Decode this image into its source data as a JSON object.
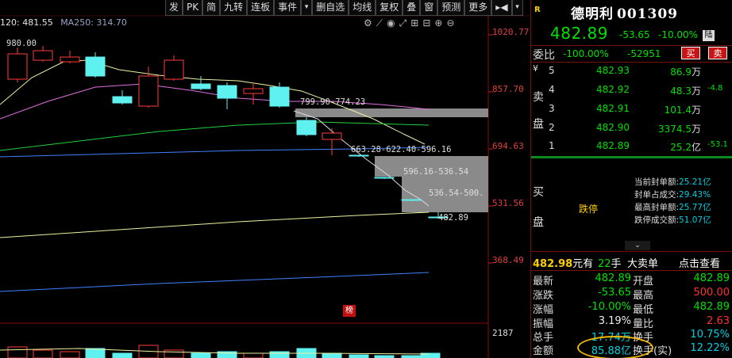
{
  "toolbar": {
    "items": [
      "发",
      "PK",
      "简",
      "九转",
      "连板",
      "事件",
      "▾",
      "删自选",
      "均线",
      "复权",
      "叠",
      "窗",
      "预测",
      "更多",
      "▸◀",
      "▾"
    ]
  },
  "ma_legend": {
    "ma120": "120: 481.55",
    "ma250": "MA250: 314.70"
  },
  "chart_icons": [
    "⚙",
    "⟋",
    "◉",
    "⤢",
    "⊞",
    "⊟",
    "⊕",
    "⊖"
  ],
  "price_axis": [
    "1020.77",
    "857.70",
    "694.63",
    "531.56",
    "368.49"
  ],
  "volume_axis": "2187",
  "annotations": {
    "peak": "980.00",
    "gap1": "799.90-774.23",
    "gap2": "663.28-622.40-596.16",
    "gap3": "596.16-536.54",
    "gap4": "536.54-500.",
    "last": "482.89"
  },
  "bang_badge": "榜",
  "panel": {
    "r_badge": "R",
    "stock_name": "德明利",
    "stock_code": "001309",
    "price": "482.89",
    "change": "-53.65",
    "change_pct": "-10.00%",
    "market_badge": "陆",
    "weibi_label": "委比",
    "weibi_pct": "-100.00%",
    "weibi_diff": "-52951",
    "buy_btn": "买",
    "sell_btn": "卖",
    "sell_side": [
      "卖",
      "盘"
    ],
    "buy_side": [
      "买",
      "盘"
    ],
    "sell_book": [
      {
        "lvl": "5",
        "price": "482.93",
        "qty": "86.9",
        "unit": "万",
        "extra": ""
      },
      {
        "lvl": "4",
        "price": "482.92",
        "qty": "48.3",
        "unit": "万",
        "extra": "-4.8"
      },
      {
        "lvl": "3",
        "price": "482.91",
        "qty": "101.4",
        "unit": "万",
        "extra": ""
      },
      {
        "lvl": "2",
        "price": "482.90",
        "qty": "3374.5",
        "unit": "万",
        "extra": ""
      },
      {
        "lvl": "1",
        "price": "482.89",
        "qty": "25.2",
        "unit": "亿",
        "extra": "-53.1"
      }
    ],
    "yen_mark": "¥",
    "limit_down": "跌停",
    "seal_info": [
      {
        "label": "当前封单额:",
        "value": "25.21亿"
      },
      {
        "label": "封单占成交:",
        "value": "29.43%"
      },
      {
        "label": "最高封单额:",
        "value": "25.77亿"
      },
      {
        "label": "跌停成交额:",
        "value": "51.07亿"
      }
    ],
    "collapse": "⌄",
    "trade": {
      "price": "482.98",
      "price_unit": "元有",
      "vol": "22",
      "vol_unit": "手",
      "big_order": "大卖单",
      "click_view": "点击查看"
    },
    "quote": [
      {
        "l1": "最新",
        "v1": "482.89",
        "c1": "",
        "l2": "开盘",
        "v2": "482.89",
        "c2": ""
      },
      {
        "l1": "涨跌",
        "v1": "-53.65",
        "c1": "",
        "l2": "最高",
        "v2": "500.00",
        "c2": ""
      },
      {
        "l1": "涨幅",
        "v1": "-10.00%",
        "c1": "",
        "l2": "最低",
        "v2": "482.89",
        "c2": ""
      },
      {
        "l1": "振幅",
        "v1": "3.19%",
        "c1": "white",
        "l2": "量比",
        "v2": "2.63",
        "c2": "red"
      },
      {
        "l1": "总手",
        "v1": "17.74万",
        "c1": "cyan",
        "l2": "换手",
        "v2": "10.75%",
        "c2": "cyan"
      },
      {
        "l1": "金额",
        "v1": "85.88亿",
        "c1": "cyan",
        "l2": "换手(实)",
        "v2": "12.22%",
        "c2": "cyan"
      }
    ]
  }
}
